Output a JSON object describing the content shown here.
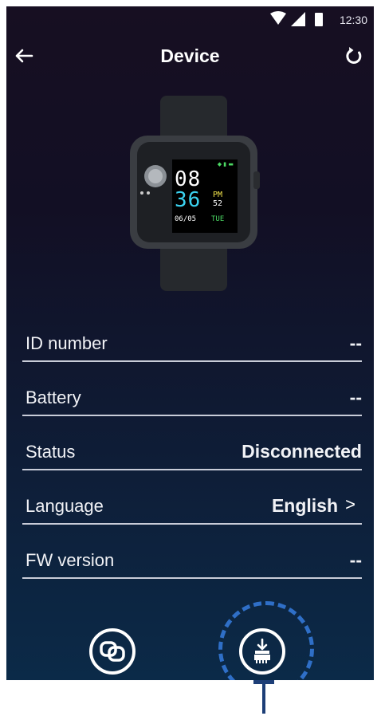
{
  "status_bar": {
    "time": "12:30"
  },
  "header": {
    "title": "Device"
  },
  "watch": {
    "time_hours": "08",
    "time_minutes": "36",
    "ampm": "PM",
    "seconds": "52",
    "date": "06/05",
    "weekday": "TUE"
  },
  "rows": [
    {
      "label": "ID number",
      "value": "--"
    },
    {
      "label": "Battery",
      "value": "--"
    },
    {
      "label": "Status",
      "value": "Disconnected"
    },
    {
      "label": "Language",
      "value": "English",
      "chevron": ">"
    },
    {
      "label": "FW version",
      "value": "--"
    }
  ],
  "icons": {
    "back": "arrow-left-icon",
    "refresh": "refresh-icon",
    "pair": "link-icon",
    "clean": "clean-brush-icon",
    "wifi": "wifi-icon",
    "signal": "signal-icon",
    "battery": "battery-icon"
  },
  "colors": {
    "background_top": "#170f22",
    "background_bottom": "#0b2a48",
    "accent_dashed": "#2f6fc7",
    "watch_cyan": "#3bd2f0",
    "watch_green": "#4cd964",
    "watch_yellow": "#f0e24b"
  }
}
